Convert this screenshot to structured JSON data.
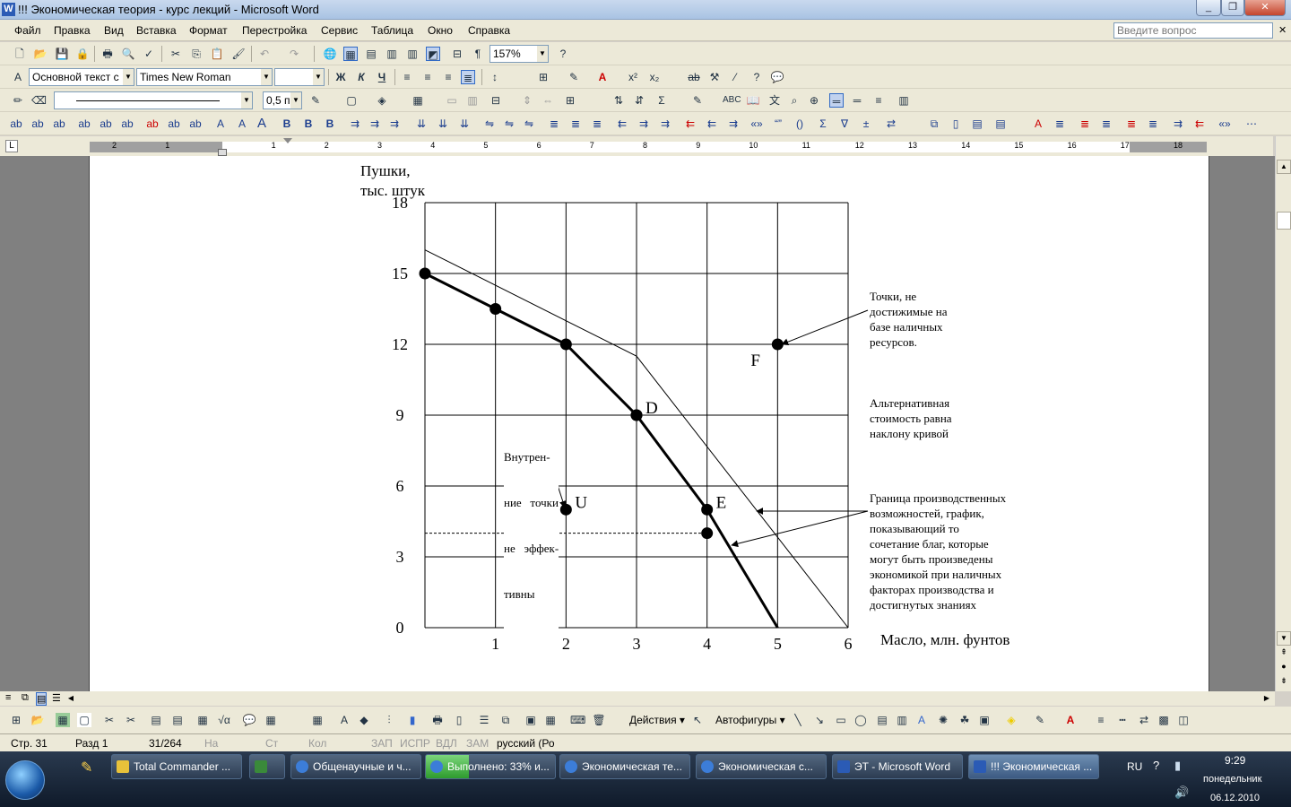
{
  "window": {
    "title": "!!! Экономическая теория - курс лекций - Microsoft Word",
    "app_icon": "W"
  },
  "menu": {
    "items": [
      "Файл",
      "Правка",
      "Вид",
      "Вставка",
      "Формат",
      "Перестройка",
      "Сервис",
      "Таблица",
      "Окно",
      "Справка"
    ],
    "help_placeholder": "Введите вопрос"
  },
  "toolbar": {
    "zoom": "157%",
    "style": "Основной текст с",
    "font": "Times New Roman",
    "line_weight": "0,5 п"
  },
  "ruler": {
    "ticks": [
      "2",
      "1",
      "1",
      "2",
      "3",
      "4",
      "5",
      "6",
      "7",
      "8",
      "9",
      "10",
      "11",
      "12",
      "13",
      "14",
      "15",
      "16",
      "17",
      "18"
    ]
  },
  "chart_data": {
    "type": "line",
    "ylabel_lines": [
      "Пушки,",
      "тыс. штук"
    ],
    "xlabel": "Масло, млн. фунтов",
    "x_ticks": [
      "1",
      "2",
      "3",
      "4",
      "5",
      "6"
    ],
    "y_ticks": [
      "0",
      "3",
      "6",
      "9",
      "12",
      "15",
      "18"
    ],
    "xlim": [
      0,
      6
    ],
    "ylim": [
      0,
      18
    ],
    "grid": true,
    "series": [
      {
        "role": "ppf",
        "x": [
          0,
          1,
          2,
          3,
          4,
          5
        ],
        "y": [
          15,
          13.5,
          12,
          9,
          5,
          0
        ]
      },
      {
        "role": "shifted",
        "x": [
          0,
          3,
          6
        ],
        "y": [
          16,
          11.5,
          0
        ]
      }
    ],
    "points": [
      {
        "label": "D",
        "x": 3,
        "y": 9
      },
      {
        "label": "E",
        "x": 4,
        "y": 5
      },
      {
        "label": "U",
        "x": 2,
        "y": 5
      },
      {
        "label": "F",
        "x": 5,
        "y": 12
      },
      {
        "label": "",
        "x": 4,
        "y": 4
      }
    ],
    "dashed_line": {
      "y": 4,
      "x": [
        0,
        4
      ]
    },
    "annotations": {
      "unreachable": [
        "Точки, не",
        "достижимые на",
        "базе наличных",
        "ресурсов."
      ],
      "opportunity_cost": [
        "Альтернативная",
        "стоимость равна",
        "наклону кривой"
      ],
      "frontier": [
        "Граница производственных",
        "возможностей, график,",
        "показывающий то",
        "сочетание благ, которые",
        "могут быть произведены",
        "экономикой при наличных",
        "факторах производства и",
        "достигнутых знаниях"
      ],
      "inefficient": [
        "Внутрен-",
        "ние   точки",
        "не   эффек-",
        "тивны"
      ]
    }
  },
  "drawing": {
    "actions": "Действия",
    "autoshapes": "Автофигуры"
  },
  "status": {
    "page": "Стр. 31",
    "section": "Разд 1",
    "pages": "31/264",
    "at": "На",
    "line": "Ст",
    "col": "Кол",
    "rec": "ЗАП",
    "trk": "ИСПР",
    "ext": "ВДЛ",
    "ovr": "ЗАМ",
    "lang": "русский (Ро"
  },
  "taskbar": {
    "items": [
      {
        "label": "Total Commander ...",
        "color": "#e8c23a"
      },
      {
        "label": "",
        "color": "#3a8a3a"
      },
      {
        "label": "Общенаучные и ч...",
        "color": "#3c7dd8"
      },
      {
        "label": "Выполнено: 33% и...",
        "color": "#3c7dd8",
        "progress": 0.33
      },
      {
        "label": "Экономическая те...",
        "color": "#3c7dd8"
      },
      {
        "label": "Экономическая с...",
        "color": "#3c7dd8"
      },
      {
        "label": "ЭТ - Microsoft Word",
        "color": "#2b5bb5"
      },
      {
        "label": "!!! Экономическая ...",
        "color": "#2b5bb5"
      }
    ],
    "lang": "RU",
    "time": "9:29",
    "day": "понедельник",
    "date": "06.12.2010"
  }
}
